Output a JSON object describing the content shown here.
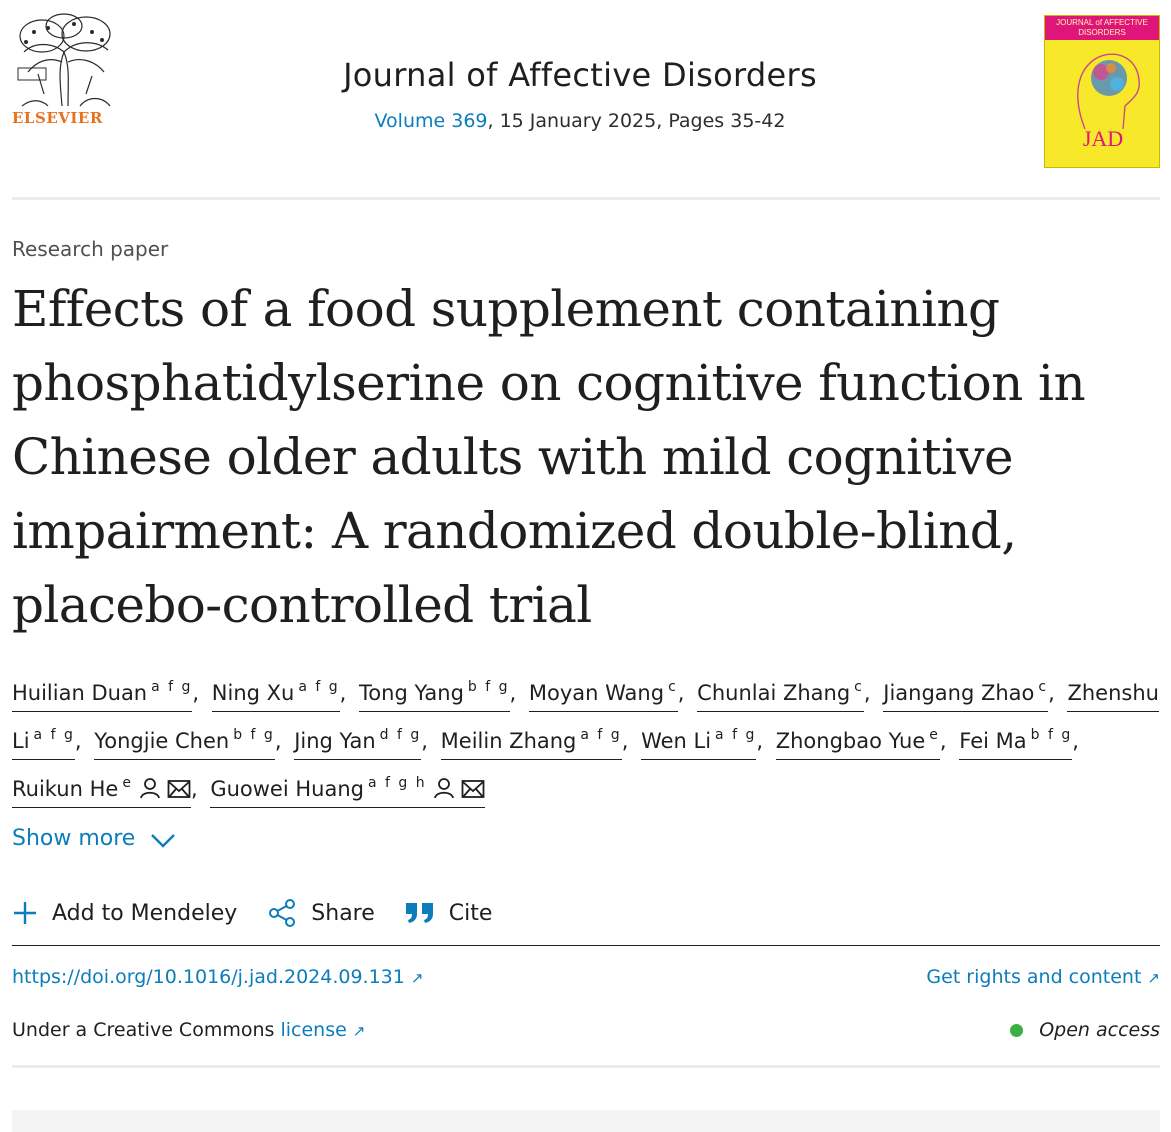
{
  "header": {
    "publisher": "ELSEVIER",
    "journal_title": "Journal of Affective Disorders",
    "volume_link": "Volume 369",
    "issue_rest": ", 15 January 2025, Pages 35-42",
    "cover": {
      "head": "JOURNAL of AFFECTIVE DISORDERS",
      "mark": "JAD"
    }
  },
  "article": {
    "type": "Research paper",
    "title": "Effects of a food supplement containing phosphatidylserine on cognitive function in Chinese older adults with mild cognitive impairment: A randomized double-blind, placebo-controlled trial"
  },
  "authors": [
    {
      "name": "Huilian Duan",
      "aff": "a f g"
    },
    {
      "name": "Ning Xu",
      "aff": "a f g"
    },
    {
      "name": "Tong Yang",
      "aff": "b f g"
    },
    {
      "name": "Moyan Wang",
      "aff": "c"
    },
    {
      "name": "Chunlai Zhang",
      "aff": "c"
    },
    {
      "name": "Jiangang Zhao",
      "aff": "c"
    },
    {
      "name": "Zhenshu Li",
      "aff": "a f g"
    },
    {
      "name": "Yongjie Chen",
      "aff": "b f g"
    },
    {
      "name": "Jing Yan",
      "aff": "d f g"
    },
    {
      "name": "Meilin Zhang",
      "aff": "a f g"
    },
    {
      "name": "Wen Li",
      "aff": "a f g"
    },
    {
      "name": "Zhongbao Yue",
      "aff": "e"
    },
    {
      "name": "Fei Ma",
      "aff": "b f g"
    },
    {
      "name": "Ruikun He",
      "aff": "e"
    },
    {
      "name": "Guowei Huang",
      "aff": "a f g h"
    }
  ],
  "show_more": "Show more",
  "toolbar": {
    "mendeley": "Add to Mendeley",
    "share": "Share",
    "cite": "Cite"
  },
  "links": {
    "doi": "https://doi.org/10.1016/j.jad.2024.09.131",
    "rights": "Get rights and content",
    "license_prefix": "Under a Creative Commons",
    "license_link": "license",
    "open_access": "Open access",
    "arrow": "↗"
  },
  "colors": {
    "link": "#0c7dbb",
    "publisher": "#e9711c",
    "open_access_dot": "#3cb043"
  }
}
